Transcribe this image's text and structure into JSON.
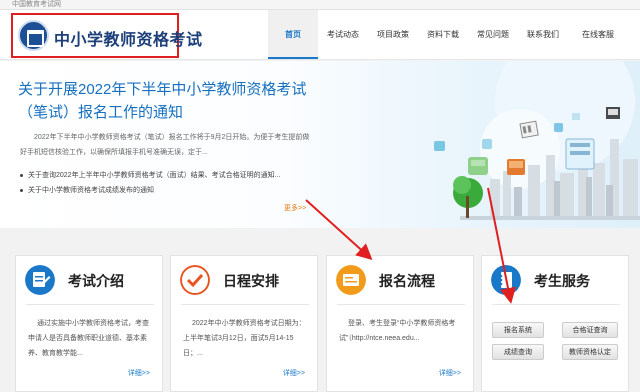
{
  "topbar": {
    "text": "中国教育考试网"
  },
  "header": {
    "logo_text": "中小学教师资格考试",
    "nav": [
      {
        "label": "首页",
        "active": true
      },
      {
        "label": "考试动态"
      },
      {
        "label": "项目政策"
      },
      {
        "label": "资料下载"
      },
      {
        "label": "常见问题"
      },
      {
        "label": "联系我们"
      },
      {
        "label": "在线客服"
      }
    ]
  },
  "banner": {
    "title": "关于开展2022年下半年中小学教师资格考试（笔试）报名工作的通知",
    "description": "2022年下半年中小学教师资格考试（笔试）报名工作将于9月2日开始。为便于考生提前做好手机短信核验工作，以确保所填报手机号准确无误，定于...",
    "news": [
      "关于查询2022年上半年中小学教师资格考试（面试）结果、考试合格证明的通知...",
      "关于中小学教师资格考试成绩发布的通知"
    ],
    "more": "更多>>"
  },
  "cards": [
    {
      "title": "考试介绍",
      "text": "通过实施中小学教师资格考试，考查申请人是否具备教师职业道德、基本素养、教育教学能...",
      "more": "详细>>",
      "accent": "#1a78c8"
    },
    {
      "title": "日程安排",
      "text": "2022年中小学教师资格考试日期为：上半年笔试3月12日，面试5月14-15日；...",
      "more": "详细>>",
      "accent": "#e8531f"
    },
    {
      "title": "报名流程",
      "text": "登录、考生登录“中小学教师资格考试”（http://ntce.neea.edu...",
      "more": "详细>>",
      "accent": "#f29a1a"
    },
    {
      "title": "考生服务",
      "accent": "#1a78c8",
      "buttons": [
        "报名系统",
        "合格证查询",
        "成绩查询",
        "教师资格认定"
      ]
    }
  ],
  "colors": {
    "highlight_box": "#e02020",
    "primary": "#1a78c8",
    "title_blue": "#1670c0",
    "logo_blue": "#1c4f93"
  }
}
